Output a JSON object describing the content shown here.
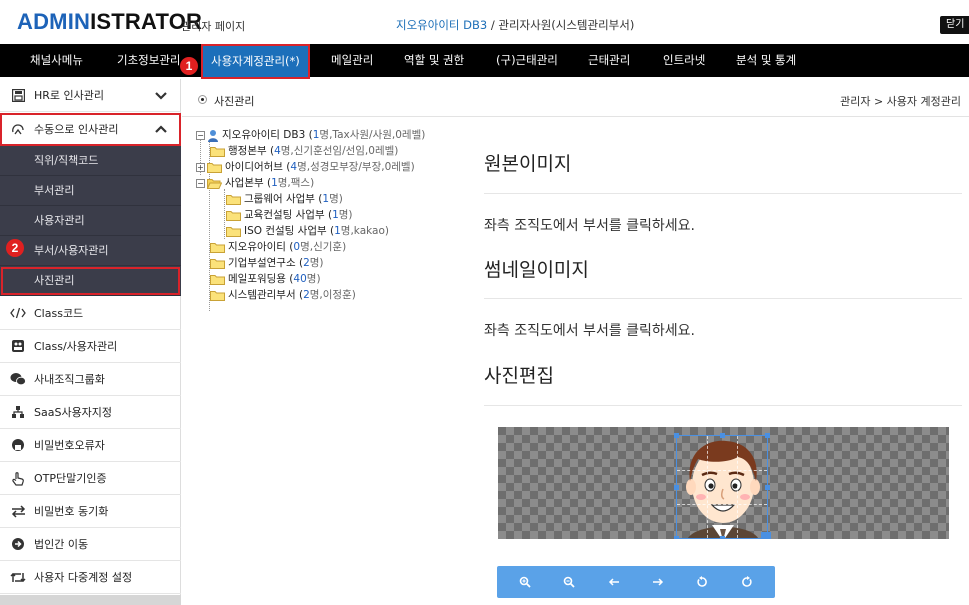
{
  "header": {
    "logo_hl": "ADMIN",
    "logo_rest": "ISTRATOR",
    "logo_sub": "관리자 페이지",
    "org_name": "지오유아이티 DB3",
    "org_sep": " / ",
    "org_user": "관리자사원(시스템관리부서)",
    "logout_label": "닫기"
  },
  "menu": {
    "items": [
      "채널사메뉴",
      "기초정보관리",
      "사용자계정관리(*)",
      "메일관리",
      "역할 및 권한",
      "(구)근태관리",
      "근태관리",
      "인트라넷",
      "분석 및 통계"
    ]
  },
  "badges": {
    "one": "1",
    "two": "2"
  },
  "sidebar": {
    "items": [
      {
        "label": "HR로 인사관리",
        "icon": "hr-icon"
      },
      {
        "label": "수동으로 인사관리",
        "icon": "manual-hr-icon"
      },
      {
        "label": "Class코드",
        "icon": "code-icon"
      },
      {
        "label": "Class/사용자관리",
        "icon": "class-user-icon"
      },
      {
        "label": "사내조직그룹화",
        "icon": "wechat-icon"
      },
      {
        "label": "SaaS사용자지정",
        "icon": "sitemap-icon"
      },
      {
        "label": "비밀번호오류자",
        "icon": "user-lock-icon"
      },
      {
        "label": "OTP단말기인증",
        "icon": "hand-pointer-icon"
      },
      {
        "label": "비밀번호 동기화",
        "icon": "exchange-icon"
      },
      {
        "label": "법인간 이동",
        "icon": "arrow-circle-icon"
      },
      {
        "label": "사용자 다중계정 설정",
        "icon": "retweet-icon"
      }
    ],
    "sub_items": [
      "직위/직책코드",
      "부서관리",
      "사용자관리",
      "부서/사용자관리",
      "사진관리"
    ]
  },
  "page": {
    "title": "사진관리",
    "breadcrumb": "관리자 > 사용자 계정관리"
  },
  "tree": {
    "root": {
      "name": "지오유아이티 DB3",
      "cnt": "1",
      "extra": "명,Tax사원/사원,0레벨)"
    },
    "nodes": [
      {
        "name": "행정본부",
        "cnt": "4",
        "extra": "명,신기훈선임/선임,0레벨)"
      },
      {
        "name": "아이디어허브",
        "cnt": "4",
        "extra": "명,성경모부장/부장,0레벨)"
      },
      {
        "name": "사업본부",
        "cnt": "1",
        "extra": "명,팩스)"
      },
      {
        "name": "그룹웨어 사업부",
        "cnt": "1",
        "extra": "명)"
      },
      {
        "name": "교육컨설팅 사업부",
        "cnt": "1",
        "extra": "명)"
      },
      {
        "name": "ISO 컨설팅 사업부",
        "cnt": "1",
        "extra": "명,kakao)"
      },
      {
        "name": "지오유아이티",
        "cnt": "0",
        "extra": "명,신기훈)"
      },
      {
        "name": "기업부설연구소",
        "cnt": "2",
        "extra": "명)"
      },
      {
        "name": "메일포워딩용",
        "cnt": "40",
        "extra": "명)"
      },
      {
        "name": "시스템관리부서",
        "cnt": "2",
        "extra": "명,이정훈)"
      }
    ]
  },
  "panel": {
    "original_title": "원본이미지",
    "original_msg": "좌측 조직도에서 부서를 클릭하세요.",
    "thumb_title": "썸네일이미지",
    "thumb_msg": "좌측 조직도에서 부서를 클릭하세요.",
    "edit_title": "사진편집"
  },
  "colors": {
    "accent": "#1c6fba",
    "highlight": "#d9232a",
    "submenu": "#3b3d4a",
    "toolbar": "#5aa2e8"
  }
}
